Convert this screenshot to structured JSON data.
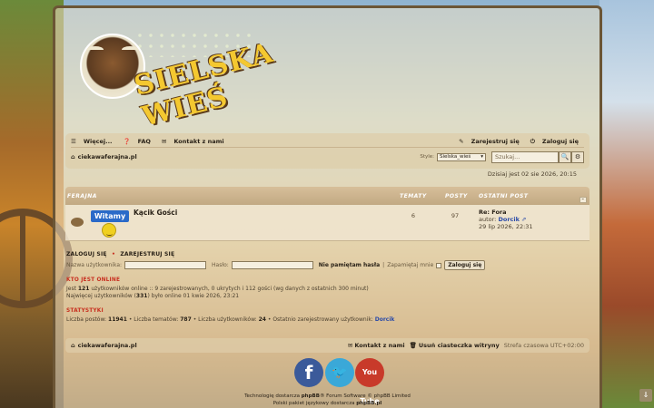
{
  "site": {
    "logo_text": "SIELSKA WIEŚ"
  },
  "navbar": {
    "more": "Więcej...",
    "faq": "FAQ",
    "contact": "Kontakt z nami",
    "register": "Zarejestruj się",
    "login": "Zaloguj się",
    "home": "ciekawaferajna.pl",
    "style_label": "Style:",
    "style_value": "Sielska_wieś",
    "search_placeholder": "Szukaj..."
  },
  "date_line": "Dzisiaj jest 02 sie 2026, 20:15",
  "forum_table": {
    "headers": {
      "category": "FERAJNA",
      "topics": "TEMATY",
      "posts": "POSTY",
      "last_post": "OSTATNI POST"
    },
    "rows": [
      {
        "badge": "Witamy",
        "title": "Kącik Gości",
        "topics": "6",
        "posts": "97",
        "last_title": "Re: Fora",
        "last_author_label": "autor:",
        "last_author": "Dorcik",
        "last_date": "29 lip 2026, 22:31"
      }
    ]
  },
  "login": {
    "title_login": "ZALOGUJ SIĘ",
    "sep": "•",
    "title_register": "ZAREJESTRUJ SIĘ",
    "username_label": "Nazwa użytkownika:",
    "password_label": "Hasło:",
    "forgot": "Nie pamiętam hasła",
    "remember": "Zapamiętaj mnie",
    "submit": "Zaloguj się"
  },
  "online": {
    "title": "KTO JEST ONLINE",
    "line1_pre": "Jest",
    "line1_count": "121",
    "line1_post": "użytkowników online :: 9 zarejestrowanych, 0 ukrytych i 112 gości (wg danych z ostatnich 300 minut)",
    "line2_pre": "Najwięcej użytkowników (",
    "line2_count": "331",
    "line2_post": ") było online 01 kwie 2026, 23:21"
  },
  "stats": {
    "title": "STATYSTYKI",
    "posts_label": "Liczba postów:",
    "posts_value": "11941",
    "topics_label": "• Liczba tematów:",
    "topics_value": "787",
    "users_label": "• Liczba użytkowników:",
    "users_value": "24",
    "newest_label": "• Ostatnio zarejestrowany użytkownik:",
    "newest_value": "Dorcik"
  },
  "footer": {
    "home": "ciekawaferajna.pl",
    "contact": "Kontakt z nami",
    "delete_cookies": "Usuń ciasteczka witryny",
    "timezone": "Strefa czasowa UTC+02:00",
    "social": {
      "facebook": "f",
      "twitter": "🐦",
      "youtube": "You Tube"
    },
    "copyright_pre": "Technologię dostarcza ",
    "copyright_phpbb": "phpBB",
    "copyright_post": "® Forum Software © phpBB Limited",
    "lang_pre": "Polski pakiet językowy dostarcza ",
    "lang_link": "phpBB.pl"
  },
  "colors": {
    "accent_red": "#c83020",
    "link_blue": "#2a4aa8",
    "nav_bg": "#decdaa"
  }
}
